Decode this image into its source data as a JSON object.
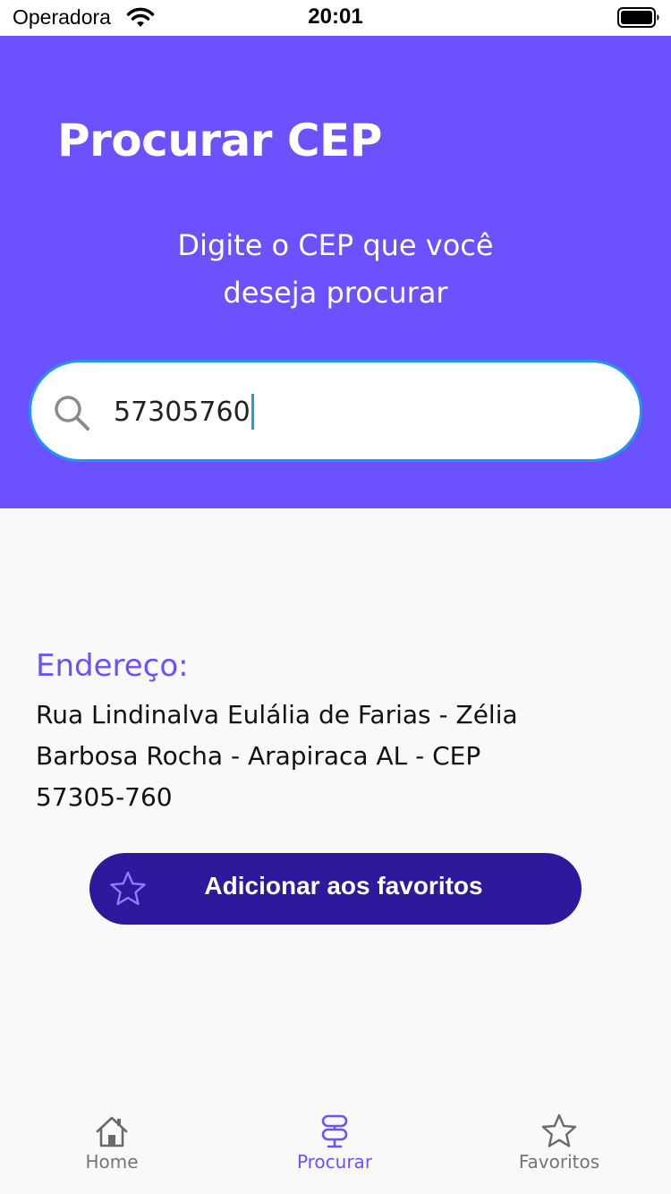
{
  "status_bar": {
    "carrier": "Operadora",
    "time": "20:01"
  },
  "header": {
    "title": "Procurar CEP",
    "subtitle": "Digite o CEP que você deseja procurar"
  },
  "search": {
    "value": "57305760",
    "icon": "search-icon"
  },
  "result": {
    "label": "Endereço:",
    "address": "Rua Lindinalva Eulália de Farias - Zélia Barbosa Rocha - Arapiraca AL - CEP 57305-760"
  },
  "favorite_button": {
    "label": "Adicionar aos favoritos",
    "icon": "star-outline-icon"
  },
  "bottom_nav": {
    "items": [
      {
        "label": "Home",
        "icon": "home-icon",
        "active": false
      },
      {
        "label": "Procurar",
        "icon": "signpost-icon",
        "active": true
      },
      {
        "label": "Favoritos",
        "icon": "star-outline-icon",
        "active": false
      }
    ]
  },
  "colors": {
    "primary": "#6c52ff",
    "button": "#2c199c",
    "focus_border": "#2196f3",
    "inactive": "#757575"
  }
}
